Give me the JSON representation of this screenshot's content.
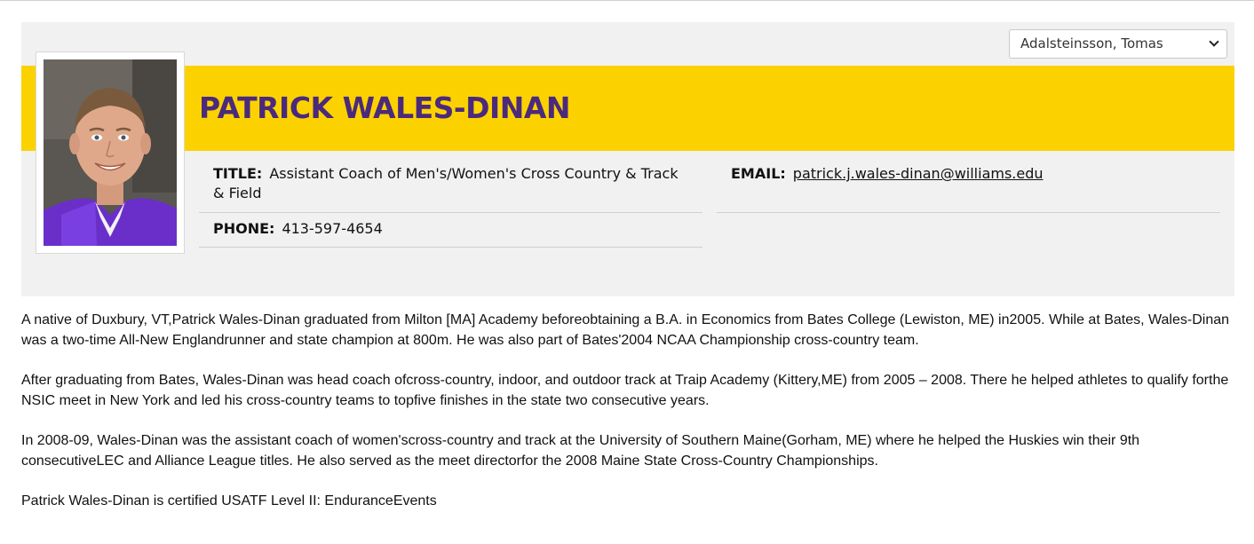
{
  "roster_select": {
    "selected": "Adalsteinsson, Tomas"
  },
  "profile": {
    "name": "PATRICK WALES-DINAN",
    "title_label": "TITLE:",
    "title_value": "Assistant Coach of Men's/Women's Cross Country & Track & Field",
    "email_label": "EMAIL:",
    "email_value": "patrick.j.wales-dinan@williams.edu",
    "phone_label": "PHONE:",
    "phone_value": "413-597-4654"
  },
  "bio": {
    "paragraphs": [
      "A native of Duxbury, VT,Patrick Wales-Dinan graduated from Milton [MA] Academy beforeobtaining a B.A. in Economics from Bates College (Lewiston, ME) in2005. While at Bates, Wales-Dinan was a two-time All-New Englandrunner and state champion at 800m. He was also part of Bates'2004 NCAA Championship cross-country team.",
      "After graduating from Bates, Wales-Dinan was head coach ofcross-country, indoor, and outdoor track at Traip Academy (Kittery,ME) from 2005 – 2008. There he helped athletes to qualify forthe NSIC meet in New York and led his cross-country teams to topfive finishes in the state two consecutive years.",
      "In 2008-09, Wales-Dinan was the assistant coach of women'scross-country and track at the University of Southern Maine(Gorham, ME) where he helped the Huskies win their 9th consecutiveLEC and Alliance League titles. He also served as the meet directorfor the 2008 Maine State Cross-Country Championships.",
      "Patrick Wales-Dinan is certified USATF Level II: EnduranceEvents"
    ]
  },
  "colors": {
    "band": "#fbd200",
    "name": "#4b2a7b",
    "card_bg": "#f1f1f1"
  },
  "icons": {
    "select_caret": "chevron-down-icon"
  }
}
